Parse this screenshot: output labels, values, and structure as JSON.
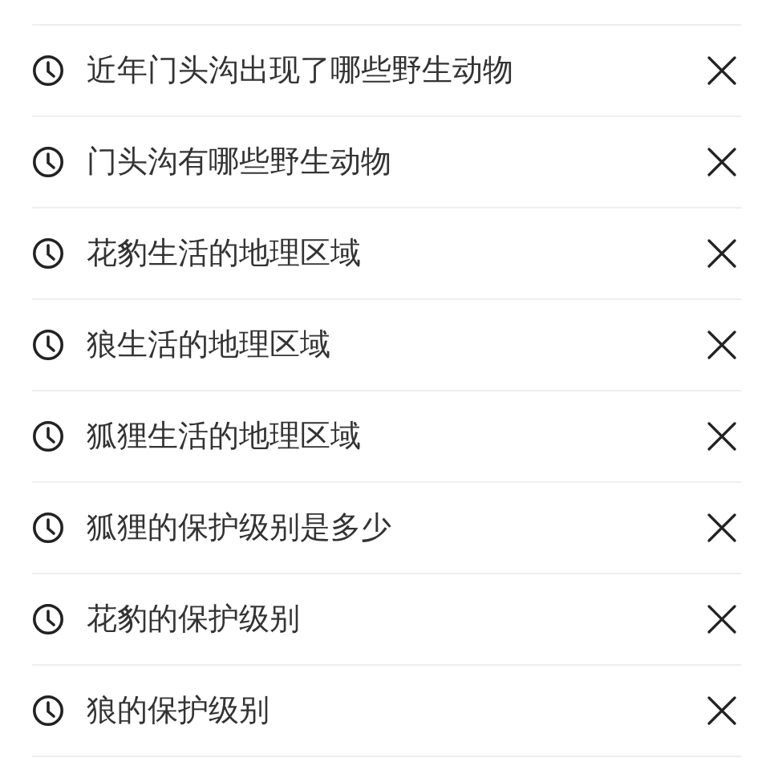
{
  "history": [
    {
      "text": "近年门头沟出现了哪些野生动物"
    },
    {
      "text": "门头沟有哪些野生动物"
    },
    {
      "text": "花豹生活的地理区域"
    },
    {
      "text": "狼生活的地理区域"
    },
    {
      "text": "狐狸生活的地理区域"
    },
    {
      "text": "狐狸的保护级别是多少"
    },
    {
      "text": "花豹的保护级别"
    },
    {
      "text": "狼的保护级别"
    }
  ]
}
